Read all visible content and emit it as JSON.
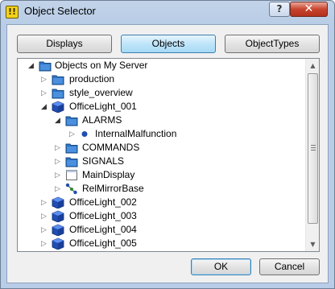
{
  "window": {
    "title": "Object Selector",
    "help_label": "?",
    "close_label": "✕",
    "app_icon_label": "!!"
  },
  "tabs": [
    {
      "label": "Displays",
      "active": false
    },
    {
      "label": "Objects",
      "active": true
    },
    {
      "label": "ObjectTypes",
      "active": false
    }
  ],
  "tree": {
    "items": [
      {
        "label": "Objects on My Server",
        "icon": "server-icon",
        "expanded": true
      },
      {
        "label": "production",
        "icon": "folder-icon",
        "expanded": false
      },
      {
        "label": "style_overview",
        "icon": "folder-icon",
        "expanded": false
      },
      {
        "label": "OfficeLight_001",
        "icon": "cube-icon",
        "expanded": true
      },
      {
        "label": "ALARMS",
        "icon": "folder-icon",
        "expanded": true
      },
      {
        "label": "InternalMalfunction",
        "icon": "dot-icon",
        "expanded": false
      },
      {
        "label": "COMMANDS",
        "icon": "folder-icon",
        "expanded": false
      },
      {
        "label": "SIGNALS",
        "icon": "folder-icon",
        "expanded": false
      },
      {
        "label": "MainDisplay",
        "icon": "display-icon",
        "expanded": false
      },
      {
        "label": "RelMirrorBase",
        "icon": "relation-icon",
        "expanded": false
      },
      {
        "label": "OfficeLight_002",
        "icon": "cube-icon",
        "expanded": false
      },
      {
        "label": "OfficeLight_003",
        "icon": "cube-icon",
        "expanded": false
      },
      {
        "label": "OfficeLight_004",
        "icon": "cube-icon",
        "expanded": false
      },
      {
        "label": "OfficeLight_005",
        "icon": "cube-icon",
        "expanded": false
      }
    ]
  },
  "buttons": {
    "ok": "OK",
    "cancel": "Cancel"
  },
  "colors": {
    "accent_blue": "#1c5fa8",
    "folder_blue": "#2e74c6",
    "close_red": "#c7442d"
  }
}
